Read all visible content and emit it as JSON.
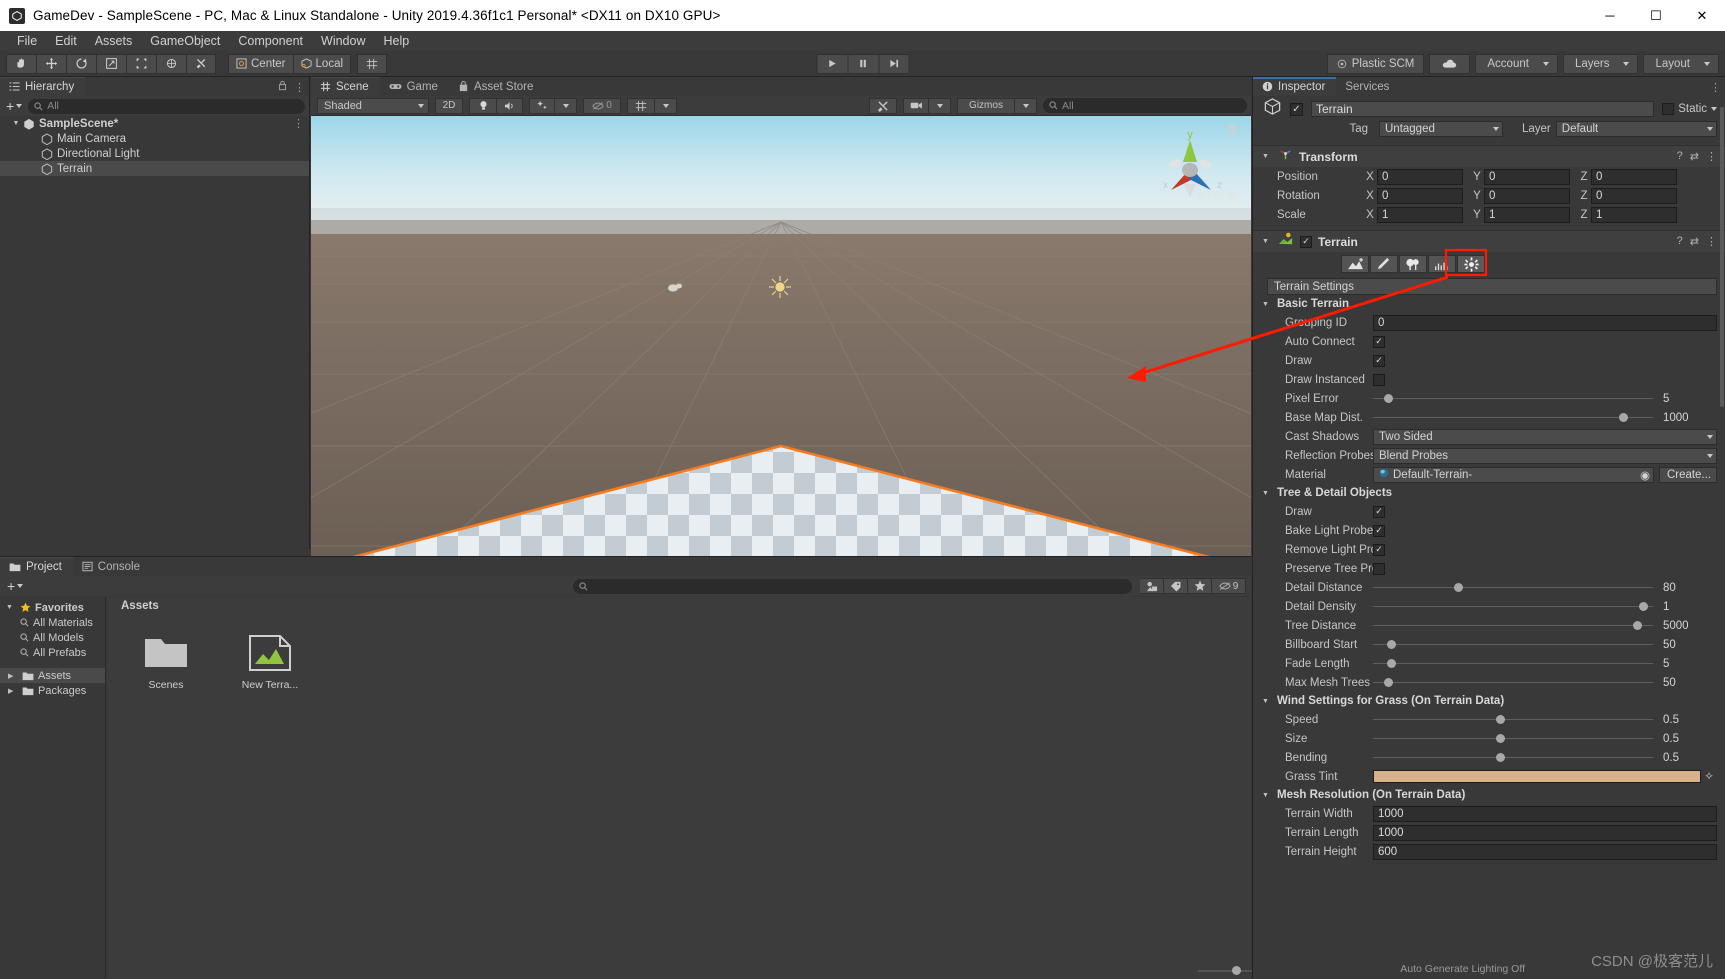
{
  "window": {
    "title": "GameDev - SampleScene - PC, Mac & Linux Standalone - Unity 2019.4.36f1c1 Personal* <DX11 on DX10 GPU>",
    "app_icon": "unity-icon",
    "minimize": "─",
    "maximize": "☐",
    "close": "✕"
  },
  "menu": {
    "items": [
      "File",
      "Edit",
      "Assets",
      "GameObject",
      "Component",
      "Window",
      "Help"
    ]
  },
  "toolbar": {
    "tools": [
      {
        "name": "hand-tool",
        "glyph": "✋"
      },
      {
        "name": "move-tool",
        "glyph": "✥"
      },
      {
        "name": "rotate-tool",
        "glyph": "↻"
      },
      {
        "name": "scale-tool",
        "glyph": "⤡"
      },
      {
        "name": "rect-tool",
        "glyph": "⬚"
      },
      {
        "name": "transform-tool",
        "glyph": "⯀"
      },
      {
        "name": "custom-tool",
        "glyph": "⚒"
      }
    ],
    "pivot_mode": "Center",
    "pivot_rotation": "Local",
    "grid_snap": "grid-icon",
    "play": "▶",
    "pause": "‖",
    "step": "▶|",
    "plastic_scm": "Plastic SCM",
    "cloud": "cloud-icon",
    "account": "Account",
    "layers": "Layers",
    "layout": "Layout"
  },
  "hierarchy": {
    "tab": "Hierarchy",
    "tab_icon": "hierarchy-icon",
    "add_label": "+",
    "search_placeholder": "All",
    "rows": [
      {
        "label": "SampleScene*",
        "depth": 0,
        "icon": "scene-icon",
        "expanded": true,
        "selected": false,
        "bold": true
      },
      {
        "label": "Main Camera",
        "depth": 1,
        "icon": "gameobject-icon",
        "expanded": false,
        "selected": false,
        "bold": false
      },
      {
        "label": "Directional Light",
        "depth": 1,
        "icon": "gameobject-icon",
        "expanded": false,
        "selected": false,
        "bold": false
      },
      {
        "label": "Terrain",
        "depth": 1,
        "icon": "gameobject-icon",
        "expanded": false,
        "selected": true,
        "bold": false
      }
    ]
  },
  "scene": {
    "tabs": [
      {
        "label": "Scene",
        "icon": "scene-grid-icon",
        "active": true
      },
      {
        "label": "Game",
        "icon": "gamepad-icon",
        "active": false
      },
      {
        "label": "Asset Store",
        "icon": "store-icon",
        "active": false
      }
    ],
    "shading_mode": "Shaded",
    "view_2d": "2D",
    "lighting_icon": "light-bulb-icon",
    "audio_icon": "audio-icon",
    "fx_icon": "fx-icon",
    "hidden_count": "0",
    "grid_icon": "grid-visibility-icon",
    "tools_icon": "scene-tools-icon",
    "camera_icon": "camera-icon",
    "gizmos": "Gizmos",
    "search_placeholder": "All",
    "gizmo_axes": {
      "x": "x",
      "y": "y",
      "z": "z",
      "projection": "≤ Persp"
    }
  },
  "project": {
    "tabs": [
      {
        "label": "Project",
        "icon": "folder-icon",
        "active": true
      },
      {
        "label": "Console",
        "icon": "console-icon",
        "active": false
      }
    ],
    "add_label": "+",
    "search_placeholder": "",
    "favorites_label": "Favorites",
    "favorites": [
      "All Materials",
      "All Models",
      "All Prefabs"
    ],
    "tree": [
      "Assets",
      "Packages"
    ],
    "breadcrumb": "Assets",
    "hidden_badge": "9",
    "assets": [
      {
        "label": "Scenes",
        "type": "folder"
      },
      {
        "label": "New Terra...",
        "type": "terrain-data"
      }
    ]
  },
  "inspector": {
    "tabs": [
      {
        "label": "Inspector",
        "icon": "info-icon",
        "active": true
      },
      {
        "label": "Services",
        "icon": "",
        "active": false
      }
    ],
    "object_name": "Terrain",
    "object_enabled": true,
    "static_label": "Static",
    "tag_label": "Tag",
    "tag_value": "Untagged",
    "layer_label": "Layer",
    "layer_value": "Default",
    "transform": {
      "title": "Transform",
      "rows": [
        {
          "label": "Position",
          "x": "0",
          "y": "0",
          "z": "0"
        },
        {
          "label": "Rotation",
          "x": "0",
          "y": "0",
          "z": "0"
        },
        {
          "label": "Scale",
          "x": "1",
          "y": "1",
          "z": "1"
        }
      ],
      "axis_labels": [
        "X",
        "Y",
        "Z"
      ]
    },
    "terrain": {
      "title": "Terrain",
      "enabled": true,
      "tools": [
        {
          "name": "create-neighbor-terrains-tool",
          "active": false
        },
        {
          "name": "paint-terrain-tool",
          "active": false
        },
        {
          "name": "paint-trees-tool",
          "active": false
        },
        {
          "name": "paint-details-tool",
          "active": false
        },
        {
          "name": "terrain-settings-tool",
          "active": true
        }
      ],
      "tool_title": "Terrain Settings",
      "sections": [
        {
          "title": "Basic Terrain",
          "rows": [
            {
              "label": "Grouping ID",
              "type": "number",
              "value": "0"
            },
            {
              "label": "Auto Connect",
              "type": "checkbox",
              "value": true
            },
            {
              "label": "Draw",
              "type": "checkbox",
              "value": true
            },
            {
              "label": "Draw Instanced",
              "type": "checkbox",
              "value": false
            },
            {
              "label": "Pixel Error",
              "type": "slider",
              "value": "5",
              "pct": 4
            },
            {
              "label": "Base Map Dist.",
              "type": "slider",
              "value": "1000",
              "pct": 88
            },
            {
              "label": "Cast Shadows",
              "type": "dropdown",
              "value": "Two Sided"
            },
            {
              "label": "Reflection Probes",
              "type": "dropdown",
              "value": "Blend Probes"
            },
            {
              "label": "Material",
              "type": "object",
              "value": "Default-Terrain-",
              "button": "Create..."
            }
          ]
        },
        {
          "title": "Tree & Detail Objects",
          "rows": [
            {
              "label": "Draw",
              "type": "checkbox",
              "value": true
            },
            {
              "label": "Bake Light Probes",
              "type": "checkbox",
              "value": true
            },
            {
              "label": "Remove Light Prot",
              "type": "checkbox",
              "value": true
            },
            {
              "label": "Preserve Tree Prot",
              "type": "checkbox",
              "value": false
            },
            {
              "label": "Detail Distance",
              "type": "slider",
              "value": "80",
              "pct": 29
            },
            {
              "label": "Detail Density",
              "type": "slider",
              "value": "1",
              "pct": 95
            },
            {
              "label": "Tree Distance",
              "type": "slider",
              "value": "5000",
              "pct": 93
            },
            {
              "label": "Billboard Start",
              "type": "slider",
              "value": "50",
              "pct": 5
            },
            {
              "label": "Fade Length",
              "type": "slider",
              "value": "5",
              "pct": 5
            },
            {
              "label": "Max Mesh Trees",
              "type": "slider",
              "value": "50",
              "pct": 4
            }
          ]
        },
        {
          "title": "Wind Settings for Grass (On Terrain Data)",
          "rows": [
            {
              "label": "Speed",
              "type": "slider",
              "value": "0.5",
              "pct": 44
            },
            {
              "label": "Size",
              "type": "slider",
              "value": "0.5",
              "pct": 44
            },
            {
              "label": "Bending",
              "type": "slider",
              "value": "0.5",
              "pct": 44
            },
            {
              "label": "Grass Tint",
              "type": "color",
              "value": "#d7b18c"
            }
          ]
        },
        {
          "title": "Mesh Resolution (On Terrain Data)",
          "rows": [
            {
              "label": "Terrain Width",
              "type": "number",
              "value": "1000"
            },
            {
              "label": "Terrain Length",
              "type": "number",
              "value": "1000"
            },
            {
              "label": "Terrain Height",
              "type": "number",
              "value": "600"
            }
          ]
        }
      ]
    }
  },
  "status": {
    "auto_generate_lighting": "Auto Generate Lighting Off"
  },
  "watermark": "CSDN @极客范儿",
  "annotation": {
    "color": "#ff1a00",
    "highlight_color": "#ff1a00",
    "description": "red-arrow-pointing-to-terrain-settings-tool"
  }
}
